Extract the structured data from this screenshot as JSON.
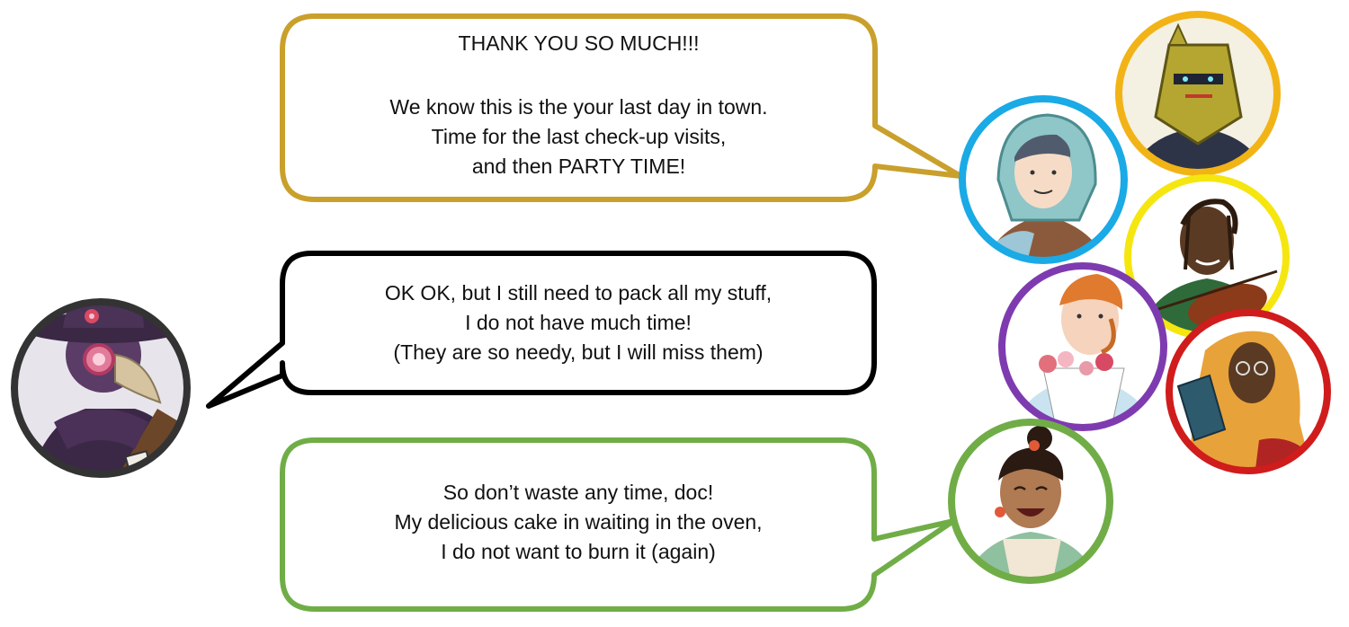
{
  "scene": {
    "dialogues": [
      {
        "speaker": "townsfolk-group",
        "border_color": "#C9A02C",
        "lines": [
          "THANK YOU SO MUCH!!!",
          "",
          "We know this is the your last day in town.",
          "Time for the last check-up visits,",
          "and then PARTY TIME!"
        ]
      },
      {
        "speaker": "plague-doctor",
        "border_color": "#000000",
        "lines": [
          "OK OK, but I still need to pack all my stuff,",
          "I do not have much time!",
          "(They are so needy, but I will miss them)"
        ]
      },
      {
        "speaker": "baker",
        "border_color": "#70AD47",
        "lines": [
          "So don’t waste any time, doc!",
          "My delicious cake in waiting in the oven,",
          "I do not want to burn it (again)"
        ]
      }
    ],
    "portraits": [
      {
        "name": "plague-doctor",
        "ring_color": "#333333"
      },
      {
        "name": "knight",
        "ring_color": "#F2B316"
      },
      {
        "name": "hooded-youth",
        "ring_color": "#1AAAE5"
      },
      {
        "name": "violinist",
        "ring_color": "#F5E60F"
      },
      {
        "name": "florist",
        "ring_color": "#7E3BB0"
      },
      {
        "name": "scholar",
        "ring_color": "#D01C1C"
      },
      {
        "name": "baker",
        "ring_color": "#70AD47"
      }
    ]
  }
}
